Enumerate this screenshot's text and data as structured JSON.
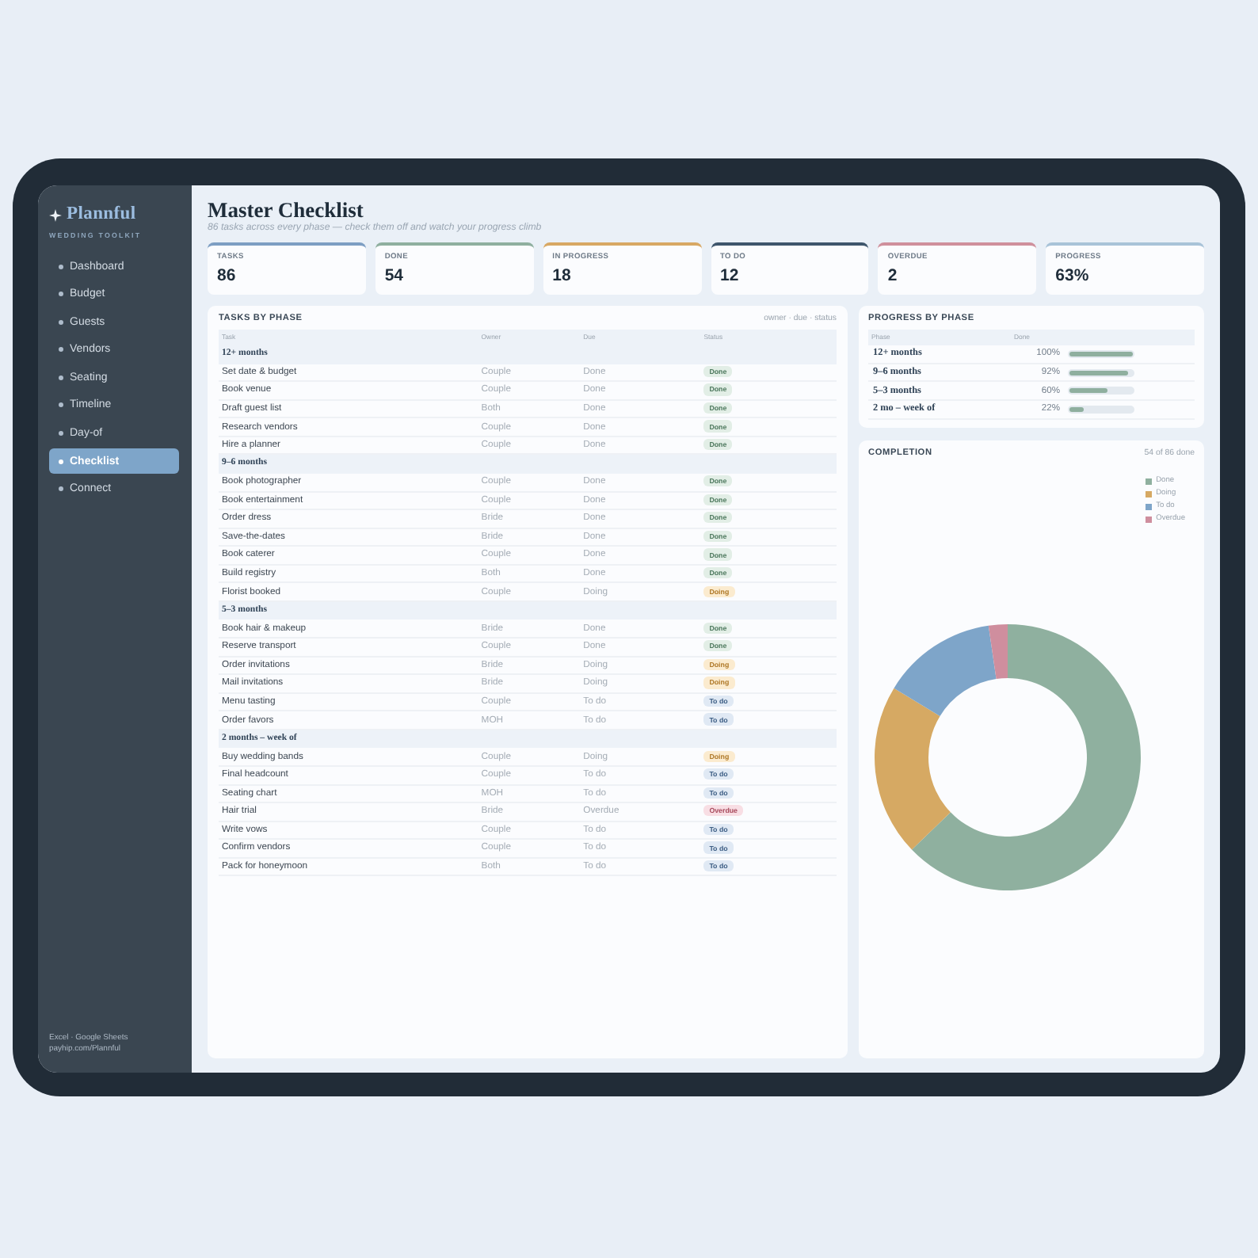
{
  "sidebar": {
    "brand": "Plannful",
    "tagline": "WEDDING TOOLKIT",
    "items": [
      {
        "label": "Dashboard",
        "selected": false
      },
      {
        "label": "Budget",
        "selected": false
      },
      {
        "label": "Guests",
        "selected": false
      },
      {
        "label": "Vendors",
        "selected": false
      },
      {
        "label": "Seating",
        "selected": false
      },
      {
        "label": "Timeline",
        "selected": false
      },
      {
        "label": "Day-of",
        "selected": false
      },
      {
        "label": "Checklist",
        "selected": true
      },
      {
        "label": "Connect",
        "selected": false
      }
    ],
    "footer": [
      "Excel · Google Sheets",
      "payhip.com/Plannful"
    ]
  },
  "header": {
    "title": "Master Checklist",
    "subtitle": "86 tasks across every phase — check them off and watch your progress climb"
  },
  "stats": [
    {
      "label": "TASKS",
      "value": "86",
      "color": "#7d9ec3"
    },
    {
      "label": "DONE",
      "value": "54",
      "color": "#8faf9f"
    },
    {
      "label": "IN PROGRESS",
      "value": "18",
      "color": "#d8a864"
    },
    {
      "label": "TO DO",
      "value": "12",
      "color": "#3f566c"
    },
    {
      "label": "OVERDUE",
      "value": "2",
      "color": "#cf909c"
    },
    {
      "label": "PROGRESS",
      "value": "63%",
      "color": "#a8c3d8"
    }
  ],
  "tasks": {
    "title": "TASKS BY PHASE",
    "note": "owner · due · status",
    "columns": [
      "Task",
      "Owner",
      "Due",
      "Status"
    ],
    "groups": [
      {
        "phase": "12+ months",
        "rows": [
          {
            "task": "Set date & budget",
            "owner": "Couple",
            "due": "Done",
            "status": "Done",
            "kind": "done"
          },
          {
            "task": "Book venue",
            "owner": "Couple",
            "due": "Done",
            "status": "Done",
            "kind": "done"
          },
          {
            "task": "Draft guest list",
            "owner": "Both",
            "due": "Done",
            "status": "Done",
            "kind": "done"
          },
          {
            "task": "Research vendors",
            "owner": "Couple",
            "due": "Done",
            "status": "Done",
            "kind": "done"
          },
          {
            "task": "Hire a planner",
            "owner": "Couple",
            "due": "Done",
            "status": "Done",
            "kind": "done"
          }
        ]
      },
      {
        "phase": "9–6 months",
        "rows": [
          {
            "task": "Book photographer",
            "owner": "Couple",
            "due": "Done",
            "status": "Done",
            "kind": "done"
          },
          {
            "task": "Book entertainment",
            "owner": "Couple",
            "due": "Done",
            "status": "Done",
            "kind": "done"
          },
          {
            "task": "Order dress",
            "owner": "Bride",
            "due": "Done",
            "status": "Done",
            "kind": "done"
          },
          {
            "task": "Save-the-dates",
            "owner": "Bride",
            "due": "Done",
            "status": "Done",
            "kind": "done"
          },
          {
            "task": "Book caterer",
            "owner": "Couple",
            "due": "Done",
            "status": "Done",
            "kind": "done"
          },
          {
            "task": "Build registry",
            "owner": "Both",
            "due": "Done",
            "status": "Done",
            "kind": "done"
          },
          {
            "task": "Florist booked",
            "owner": "Couple",
            "due": "Doing",
            "status": "Doing",
            "kind": "doing"
          }
        ]
      },
      {
        "phase": "5–3 months",
        "rows": [
          {
            "task": "Book hair & makeup",
            "owner": "Bride",
            "due": "Done",
            "status": "Done",
            "kind": "done"
          },
          {
            "task": "Reserve transport",
            "owner": "Couple",
            "due": "Done",
            "status": "Done",
            "kind": "done"
          },
          {
            "task": "Order invitations",
            "owner": "Bride",
            "due": "Doing",
            "status": "Doing",
            "kind": "doing"
          },
          {
            "task": "Mail invitations",
            "owner": "Bride",
            "due": "Doing",
            "status": "Doing",
            "kind": "doing"
          },
          {
            "task": "Menu tasting",
            "owner": "Couple",
            "due": "To do",
            "status": "To do",
            "kind": "todo"
          },
          {
            "task": "Order favors",
            "owner": "MOH",
            "due": "To do",
            "status": "To do",
            "kind": "todo"
          }
        ]
      },
      {
        "phase": "2 months – week of",
        "rows": [
          {
            "task": "Buy wedding bands",
            "owner": "Couple",
            "due": "Doing",
            "status": "Doing",
            "kind": "doing"
          },
          {
            "task": "Final headcount",
            "owner": "Couple",
            "due": "To do",
            "status": "To do",
            "kind": "todo"
          },
          {
            "task": "Seating chart",
            "owner": "MOH",
            "due": "To do",
            "status": "To do",
            "kind": "todo"
          },
          {
            "task": "Hair trial",
            "owner": "Bride",
            "due": "Overdue",
            "status": "Overdue",
            "kind": "overdue"
          },
          {
            "task": "Write vows",
            "owner": "Couple",
            "due": "To do",
            "status": "To do",
            "kind": "todo"
          },
          {
            "task": "Confirm vendors",
            "owner": "Couple",
            "due": "To do",
            "status": "To do",
            "kind": "todo"
          },
          {
            "task": "Pack for honeymoon",
            "owner": "Both",
            "due": "To do",
            "status": "To do",
            "kind": "todo"
          }
        ]
      }
    ]
  },
  "progress": {
    "title": "PROGRESS BY PHASE",
    "columns": [
      "Phase",
      "Done"
    ],
    "rows": [
      {
        "phase": "12+ months",
        "percent": "100%",
        "level": 1.0
      },
      {
        "phase": "9–6 months",
        "percent": "92%",
        "level": 0.92
      },
      {
        "phase": "5–3 months",
        "percent": "60%",
        "level": 0.6
      },
      {
        "phase": "2 mo – week of",
        "percent": "22%",
        "level": 0.22
      }
    ]
  },
  "completion": {
    "title": "COMPLETION",
    "summary": "54 of 86 done",
    "legend": [
      {
        "color": "#8fb09f"
      },
      {
        "color": "#d6a963"
      },
      {
        "color": "#7ea5c9"
      },
      {
        "color": "#cf8e9e"
      }
    ],
    "chart_data": {
      "type": "donut",
      "categories": [
        "Done",
        "Doing",
        "To do",
        "Overdue"
      ],
      "values": [
        62.8,
        20.9,
        14.0,
        2.3
      ]
    }
  }
}
